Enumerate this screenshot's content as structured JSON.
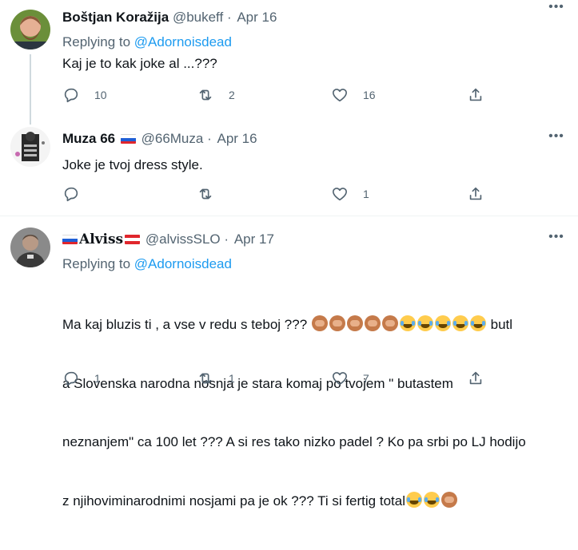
{
  "tweets": [
    {
      "name": "Boštjan Koražija",
      "handle": "@bukeff",
      "dot": "·",
      "date": "Apr 16",
      "replying_prefix": "Replying to ",
      "replying_to": "@Adornoisdead",
      "text": "Kaj je to kak joke al ...???",
      "replies": "10",
      "retweets": "2",
      "likes": "16"
    },
    {
      "name": "Muza 66",
      "handle": "@66Muza",
      "dot": "·",
      "date": "Apr 16",
      "text": "Joke je tvoj dress style.",
      "replies": "",
      "retweets": "",
      "likes": "1"
    },
    {
      "name": "Alviss",
      "handle": "@alvissSLO",
      "dot": "·",
      "date": "Apr 17",
      "replying_prefix": "Replying to ",
      "replying_to": "@Adornoisdead",
      "text_line1": "Ma kaj bluzis ti , a vse v redu s teboj ???",
      "text_line1_tail": "butl",
      "text_line2": "a Slovenska narodna nosnja je stara komaj po tvojem \" butastem",
      "text_line3": "neznanjem\" ca 100 let ??? A si res tako nizko padel ? Ko pa srbi po LJ hodijo",
      "text_line4": "z njihoviminarodnimi nosjami pa je ok ??? Ti si fertig total",
      "replies": "1",
      "retweets": "1",
      "likes": "7"
    }
  ],
  "icons": {
    "more": "more-icon",
    "reply": "reply-icon",
    "retweet": "retweet-icon",
    "like": "like-icon",
    "share": "share-icon",
    "flag_slovenia": "slovenia-flag-icon",
    "flag_austria": "austria-flag-icon",
    "emoji_monkey": "see-no-evil-monkey-icon",
    "emoji_laugh": "tears-of-joy-icon"
  },
  "colors": {
    "link": "#1d9bf0",
    "secondary_text": "#536471",
    "thread_line": "#cfd9de",
    "divider": "#eff3f4"
  }
}
